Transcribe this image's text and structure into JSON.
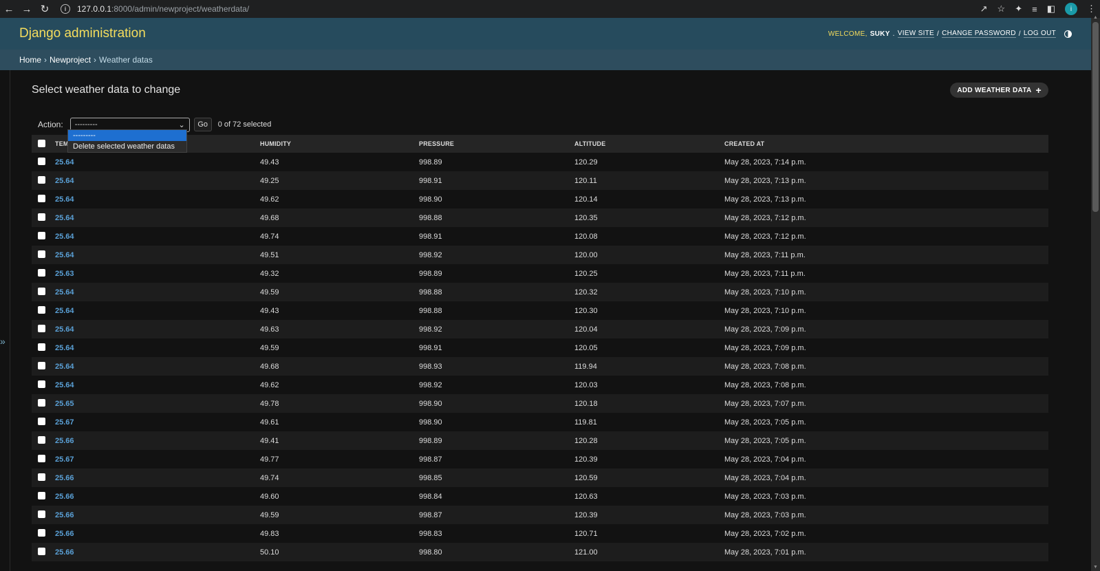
{
  "browser": {
    "url_host": "127.0.0.1",
    "url_path": ":8000/admin/newproject/weatherdata/",
    "profile_initial": "i"
  },
  "header": {
    "brand": "Django administration",
    "welcome": "Welcome,",
    "user": "Suky",
    "view_site": "View site",
    "change_password": "Change password",
    "log_out": "Log out"
  },
  "breadcrumbs": {
    "home": "Home",
    "app": "Newproject",
    "model": "Weather datas"
  },
  "page": {
    "title": "Select weather data to change",
    "add_button": "Add weather data",
    "add_symbol": "+"
  },
  "actions": {
    "label": "Action:",
    "selected_value": "---------",
    "go": "Go",
    "counter": "0 of 72 selected",
    "options": [
      "---------",
      "Delete selected weather datas"
    ]
  },
  "table": {
    "columns": [
      "Tem",
      "Humidity",
      "Pressure",
      "Altitude",
      "Created at"
    ],
    "rows": [
      [
        "25.64",
        "49.43",
        "998.89",
        "120.29",
        "May 28, 2023, 7:14 p.m."
      ],
      [
        "25.64",
        "49.25",
        "998.91",
        "120.11",
        "May 28, 2023, 7:13 p.m."
      ],
      [
        "25.64",
        "49.62",
        "998.90",
        "120.14",
        "May 28, 2023, 7:13 p.m."
      ],
      [
        "25.64",
        "49.68",
        "998.88",
        "120.35",
        "May 28, 2023, 7:12 p.m."
      ],
      [
        "25.64",
        "49.74",
        "998.91",
        "120.08",
        "May 28, 2023, 7:12 p.m."
      ],
      [
        "25.64",
        "49.51",
        "998.92",
        "120.00",
        "May 28, 2023, 7:11 p.m."
      ],
      [
        "25.63",
        "49.32",
        "998.89",
        "120.25",
        "May 28, 2023, 7:11 p.m."
      ],
      [
        "25.64",
        "49.59",
        "998.88",
        "120.32",
        "May 28, 2023, 7:10 p.m."
      ],
      [
        "25.64",
        "49.43",
        "998.88",
        "120.30",
        "May 28, 2023, 7:10 p.m."
      ],
      [
        "25.64",
        "49.63",
        "998.92",
        "120.04",
        "May 28, 2023, 7:09 p.m."
      ],
      [
        "25.64",
        "49.59",
        "998.91",
        "120.05",
        "May 28, 2023, 7:09 p.m."
      ],
      [
        "25.64",
        "49.68",
        "998.93",
        "119.94",
        "May 28, 2023, 7:08 p.m."
      ],
      [
        "25.64",
        "49.62",
        "998.92",
        "120.03",
        "May 28, 2023, 7:08 p.m."
      ],
      [
        "25.65",
        "49.78",
        "998.90",
        "120.18",
        "May 28, 2023, 7:07 p.m."
      ],
      [
        "25.67",
        "49.61",
        "998.90",
        "119.81",
        "May 28, 2023, 7:05 p.m."
      ],
      [
        "25.66",
        "49.41",
        "998.89",
        "120.28",
        "May 28, 2023, 7:05 p.m."
      ],
      [
        "25.67",
        "49.77",
        "998.87",
        "120.39",
        "May 28, 2023, 7:04 p.m."
      ],
      [
        "25.66",
        "49.74",
        "998.85",
        "120.59",
        "May 28, 2023, 7:04 p.m."
      ],
      [
        "25.66",
        "49.60",
        "998.84",
        "120.63",
        "May 28, 2023, 7:03 p.m."
      ],
      [
        "25.66",
        "49.59",
        "998.87",
        "120.39",
        "May 28, 2023, 7:03 p.m."
      ],
      [
        "25.66",
        "49.83",
        "998.83",
        "120.71",
        "May 28, 2023, 7:02 p.m."
      ],
      [
        "25.66",
        "50.10",
        "998.80",
        "121.00",
        "May 28, 2023, 7:01 p.m."
      ]
    ]
  },
  "sidebar": {
    "toggle": "»"
  },
  "colors": {
    "header_bg": "#264b5d",
    "breadcrumb_bg": "#2e4d5e",
    "brand": "#f5dd5d",
    "link": "#5aa0d6",
    "selected_option": "#1e6fd0"
  }
}
